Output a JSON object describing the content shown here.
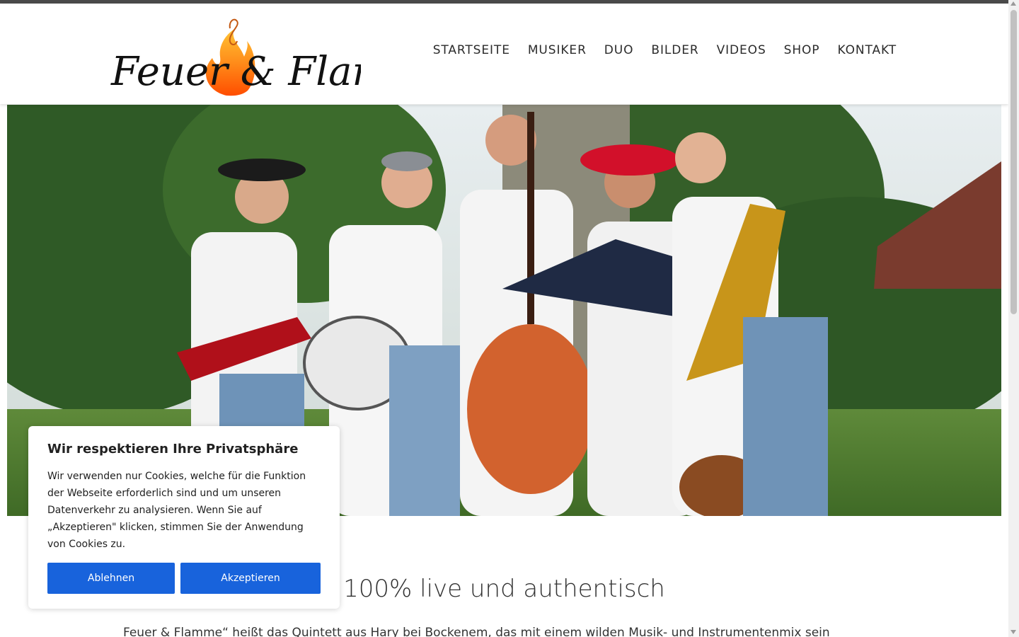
{
  "brand": {
    "logo_text": "Feuer & Flamme"
  },
  "nav": {
    "items": [
      {
        "label": "STARTSEITE"
      },
      {
        "label": "MUSIKER"
      },
      {
        "label": "DUO"
      },
      {
        "label": "BILDER"
      },
      {
        "label": "VIDEOS"
      },
      {
        "label": "SHOP"
      },
      {
        "label": "KONTAKT"
      }
    ]
  },
  "hero": {
    "image": "band-photo"
  },
  "main": {
    "headline": "100% live und authentisch",
    "intro": "Feuer & Flamme“ heißt das Quintett aus Hary bei Bockenem, das mit einem wilden Musik- und Instrumentenmix sein"
  },
  "cookie": {
    "title": "Wir respektieren Ihre Privatsphäre",
    "text": "Wir verwenden nur Cookies, welche für die Funktion der Webseite erforderlich sind und um unseren Datenverkehr zu analysieren. Wenn Sie auf „Akzeptieren\" klicken, stimmen Sie der Anwendung von Cookies zu.",
    "reject_label": "Ablehnen",
    "accept_label": "Akzeptieren"
  },
  "colors": {
    "accent": "#1863dc",
    "topbar": "#4a4a4a",
    "flame": "#f5821f"
  }
}
